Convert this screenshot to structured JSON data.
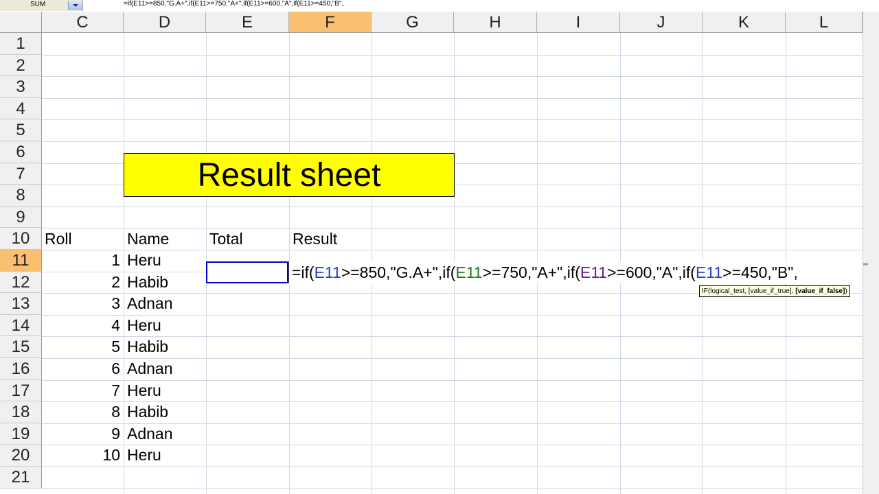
{
  "formula_bar": {
    "name_box": "SUM",
    "formula": "=if(E11>=850,\"G.A+\",if(E11>=750,\"A+\",if(E11>=600,\"A\",if(E11>=450,\"B\","
  },
  "columns": [
    "C",
    "D",
    "E",
    "F",
    "G",
    "H",
    "I",
    "J",
    "K",
    "L"
  ],
  "active_column": "F",
  "rows": [
    "1",
    "2",
    "3",
    "4",
    "5",
    "6",
    "7",
    "8",
    "9",
    "10",
    "11",
    "12",
    "13",
    "14",
    "15",
    "16",
    "17",
    "18",
    "19",
    "20",
    "21"
  ],
  "active_row": "11",
  "title": "Result sheet",
  "headers": {
    "roll": "Roll",
    "name": "Name",
    "total": "Total",
    "result": "Result"
  },
  "records": [
    {
      "roll": "1",
      "name": "Heru"
    },
    {
      "roll": "2",
      "name": "Habib"
    },
    {
      "roll": "3",
      "name": "Adnan"
    },
    {
      "roll": "4",
      "name": "Heru"
    },
    {
      "roll": "5",
      "name": "Habib"
    },
    {
      "roll": "6",
      "name": "Adnan"
    },
    {
      "roll": "7",
      "name": "Heru"
    },
    {
      "roll": "8",
      "name": "Habib"
    },
    {
      "roll": "9",
      "name": "Adnan"
    },
    {
      "roll": "10",
      "name": "Heru"
    }
  ],
  "edit": {
    "p1": "=if(",
    "r1": "E11",
    "p2": ">=850,\"G.A+\",if(",
    "r2": "E11",
    "p3": ">=750,\"A+\",if(",
    "r3": "E11",
    "p4": ">=600,\"A\",if(",
    "r4": "E11",
    "p5": ">=450,\"B\","
  },
  "tooltip": {
    "prefix": "IF(logical_test, [value_if_true], ",
    "bold": "[value_if_false]",
    "suffix": ")"
  },
  "colors": {
    "title_bg": "#ffff00",
    "active_header": "#f9c071",
    "selection": "#0000cc"
  }
}
